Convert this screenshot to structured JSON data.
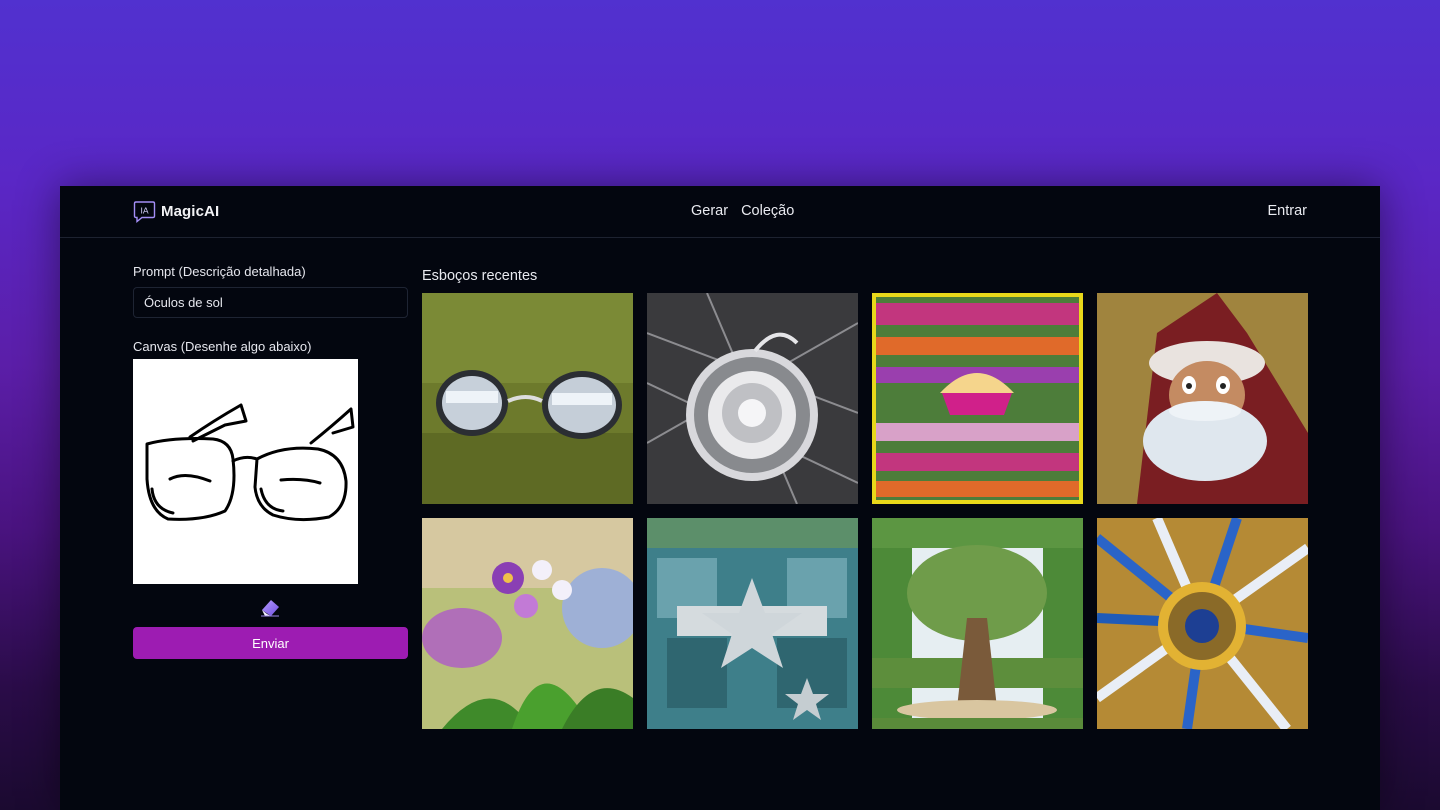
{
  "app": {
    "brand": "MagicAI",
    "logo_text": "IA"
  },
  "nav": {
    "items": [
      "Gerar",
      "Coleção"
    ],
    "login": "Entrar"
  },
  "form": {
    "prompt_label": "Prompt (Descrição detalhada)",
    "prompt_value": "Óculos de sol",
    "canvas_label": "Canvas (Desenhe algo abaixo)",
    "submit_label": "Enviar",
    "eraser_icon": "eraser-icon"
  },
  "gallery": {
    "title": "Esboços recentes",
    "items": [
      {
        "subject": "sunglasses-on-grass"
      },
      {
        "subject": "silver-flower-ornament"
      },
      {
        "subject": "cupcake-pattern"
      },
      {
        "subject": "santa-claus-figure"
      },
      {
        "subject": "purple-flowers"
      },
      {
        "subject": "star-building-facade"
      },
      {
        "subject": "big-tree-park"
      },
      {
        "subject": "blue-gold-sunburst"
      }
    ]
  },
  "colors": {
    "accent": "#9d1cb2",
    "window_bg": "#03060f",
    "background_top": "#5131cf"
  }
}
